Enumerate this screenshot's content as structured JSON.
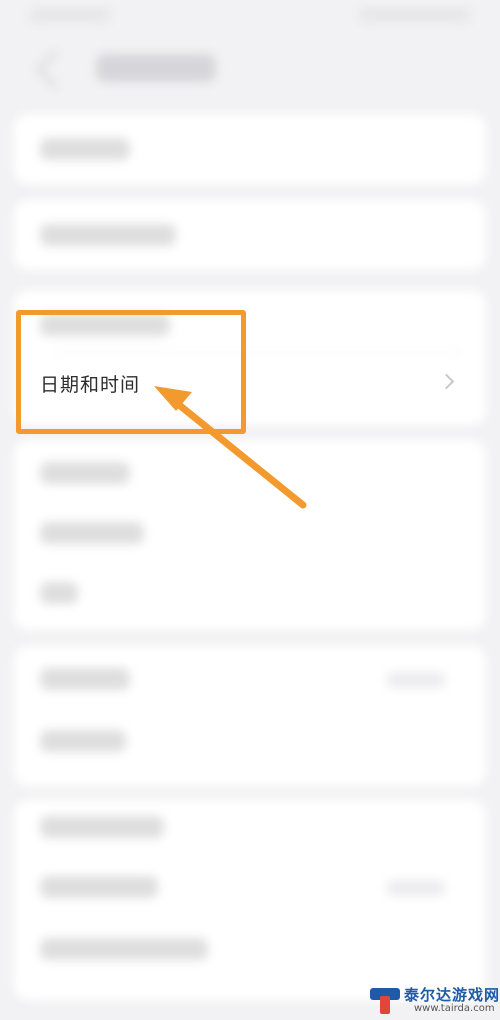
{
  "settings": {
    "highlighted_item": "日期和时间"
  },
  "annotation": {
    "highlight_color": "#f39a2f"
  },
  "watermark": {
    "brand": "泰尔达游戏网",
    "url": "www.tairda.com"
  },
  "icons": {
    "back": "back-arrow-icon",
    "chevron": "chevron-right-icon",
    "pointer": "annotation-arrow-icon",
    "logo": "tairda-logo-icon"
  }
}
